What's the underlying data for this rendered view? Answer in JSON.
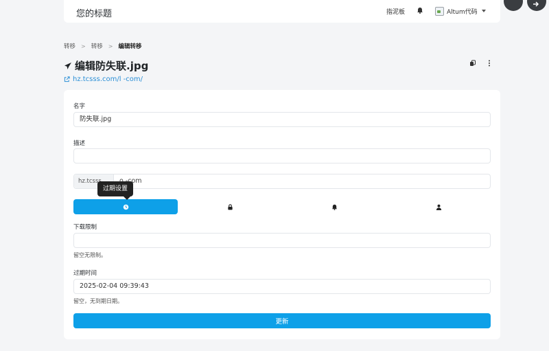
{
  "header": {
    "site_title": "您的标题",
    "clipboard_label": "指泥板",
    "username": "Altum代码"
  },
  "breadcrumb": [
    "转移",
    "转移",
    "编辑转移"
  ],
  "page": {
    "title": "编辑防失联.jpg",
    "link": "hz.tcsss.com/l          -com/"
  },
  "form": {
    "name_label": "名字",
    "name_value": "防失联.jpg",
    "description_label": "描述",
    "description_value": "",
    "url_prefix": "hz.tcsss",
    "url_suffix": "o     -com",
    "tooltip": "过期设置",
    "tabs": [
      {
        "icon": "clock-icon",
        "active": true
      },
      {
        "icon": "lock-icon",
        "active": false
      },
      {
        "icon": "bell-icon",
        "active": false
      },
      {
        "icon": "user-icon",
        "active": false
      }
    ],
    "download_limit_label": "下载限制",
    "download_limit_value": "",
    "download_limit_help": "留空无限制。",
    "expiry_label": "过期时间",
    "expiry_value": "2025-02-04 09:39:43",
    "expiry_help": "留空，无到期日期。",
    "submit_label": "更新"
  },
  "colors": {
    "accent": "#0ea0e8",
    "link": "#2b8fd6",
    "tooltip": "#222222"
  }
}
